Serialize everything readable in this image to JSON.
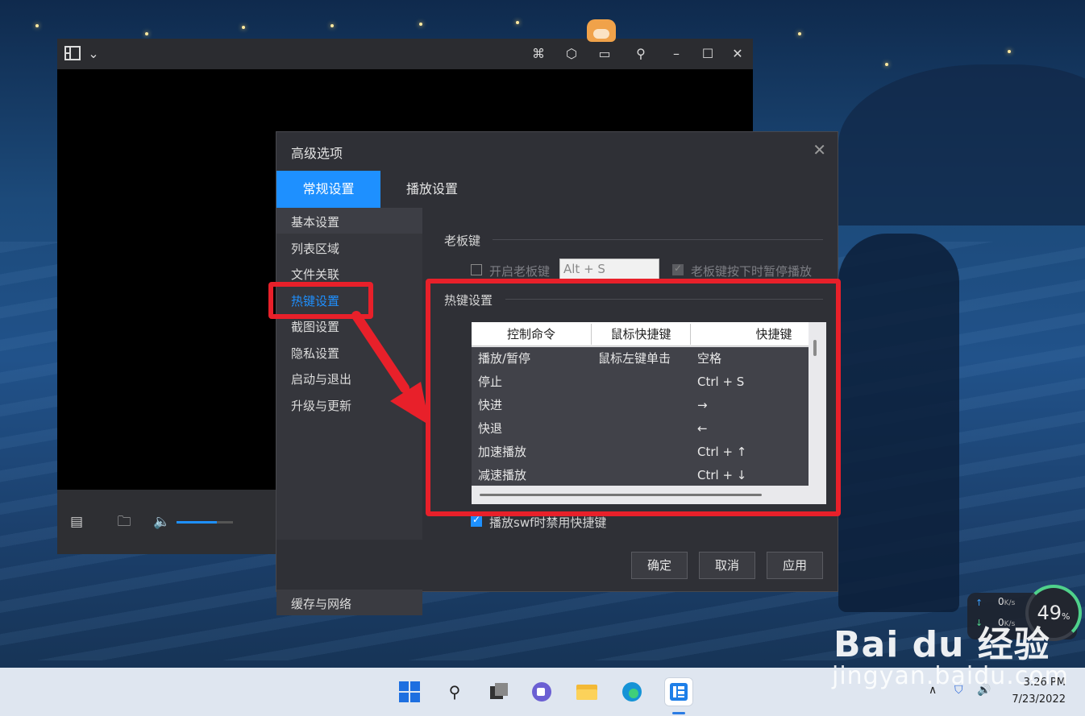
{
  "dialog": {
    "title": "高级选项",
    "tabs": [
      {
        "label": "常规设置",
        "active": true
      },
      {
        "label": "播放设置",
        "active": false
      }
    ],
    "sidebar": [
      {
        "label": "基本设置"
      },
      {
        "label": "列表区域"
      },
      {
        "label": "文件关联"
      },
      {
        "label": "热键设置",
        "active": true
      },
      {
        "label": "截图设置"
      },
      {
        "label": "隐私设置"
      },
      {
        "label": "启动与退出"
      },
      {
        "label": "升级与更新"
      }
    ],
    "sidebar_bottom": "缓存与网络",
    "boss_key": {
      "section": "老板键",
      "enable_label": "开启老板键",
      "enable_checked": false,
      "hotkey_value": "Alt + S",
      "pause_label": "老板键按下时暂停播放",
      "pause_checked": true
    },
    "hotkeys": {
      "section": "热键设置",
      "columns": [
        "控制命令",
        "鼠标快捷键",
        "快捷键"
      ],
      "rows": [
        {
          "command": "播放/暂停",
          "mouse": "鼠标左键单击",
          "key": "空格"
        },
        {
          "command": "停止",
          "mouse": "",
          "key": "Ctrl + S"
        },
        {
          "command": "快进",
          "mouse": "",
          "key": "→"
        },
        {
          "command": "快退",
          "mouse": "",
          "key": "←"
        },
        {
          "command": "加速播放",
          "mouse": "",
          "key": "Ctrl + ↑"
        },
        {
          "command": "减速播放",
          "mouse": "",
          "key": "Ctrl + ↓"
        }
      ]
    },
    "swf_option": {
      "label": "播放swf时禁用快捷键",
      "checked": true
    },
    "buttons": {
      "ok": "确定",
      "cancel": "取消",
      "apply": "应用"
    }
  },
  "network_widget": {
    "up": "0",
    "up_unit": "K/s",
    "down": "0",
    "down_unit": "K/s",
    "cpu_value": "49",
    "cpu_unit": "%"
  },
  "taskbar": {
    "time": "3:26 PM",
    "date": "7/23/2022"
  },
  "watermark": {
    "logo": "Bai du 经验",
    "url": "jingyan.baidu.com"
  },
  "colors": {
    "accent": "#1e90ff",
    "highlight": "#e8202a",
    "dialog_bg": "#2f3036"
  },
  "icons": {
    "player_titlebar": [
      "playlist-icon",
      "chevron-down-icon",
      "grid-icon",
      "cube-icon",
      "chat-icon",
      "pin-icon",
      "minimize-icon",
      "maximize-icon",
      "close-icon"
    ],
    "player_bottom": [
      "toolbox-icon",
      "folder-icon",
      "volume-icon"
    ],
    "taskbar": [
      "start-icon",
      "search-icon",
      "task-view-icon",
      "teams-icon",
      "file-explorer-icon",
      "edge-icon",
      "player-app-icon"
    ]
  }
}
